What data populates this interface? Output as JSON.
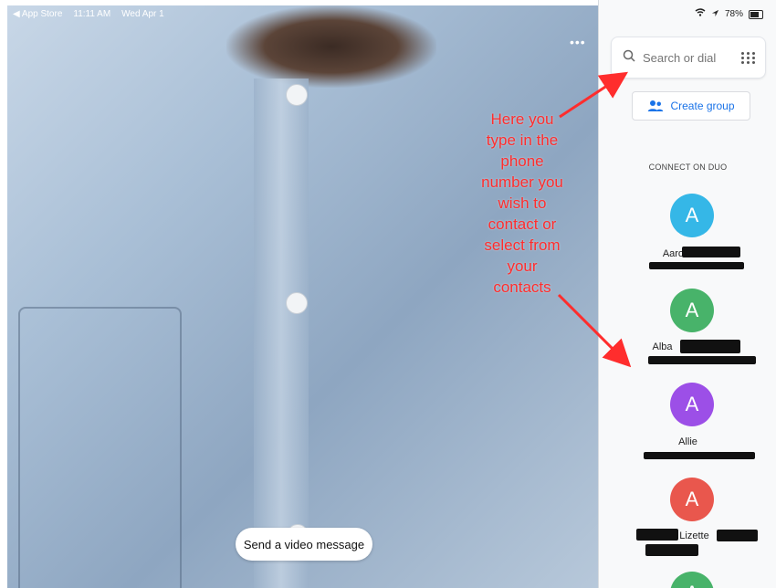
{
  "status_bar": {
    "back_label": "◀ App Store",
    "time": "11:11 AM",
    "date": "Wed Apr 1",
    "battery": "78%",
    "battery_level": 0.78
  },
  "camera": {
    "send_video_message": "Send a video message",
    "more_icon": "more-horizontal-icon"
  },
  "sidebar": {
    "search_placeholder": "Search or dial",
    "create_group": "Create group",
    "section_title": "CONNECT ON DUO",
    "contacts": [
      {
        "initial": "A",
        "name": "Aaron",
        "color": "#35b7e7"
      },
      {
        "initial": "A",
        "name": "Alba",
        "color": "#48b36a"
      },
      {
        "initial": "A",
        "name": "Allie",
        "color": "#9c4fe7"
      },
      {
        "initial": "A",
        "name": "Lizette",
        "color": "#e9574d"
      },
      {
        "initial": "A",
        "name": "",
        "color": "#48b36a"
      }
    ]
  },
  "annotation": {
    "lines": [
      "Here you",
      "type in the",
      "phone",
      "number you",
      "wish to",
      "contact or",
      "select from",
      "your",
      "contacts"
    ]
  },
  "colors": {
    "accent_blue": "#1a73e8",
    "annotation_red": "#ff2d2d",
    "sidebar_bg": "#f8f9fa"
  }
}
